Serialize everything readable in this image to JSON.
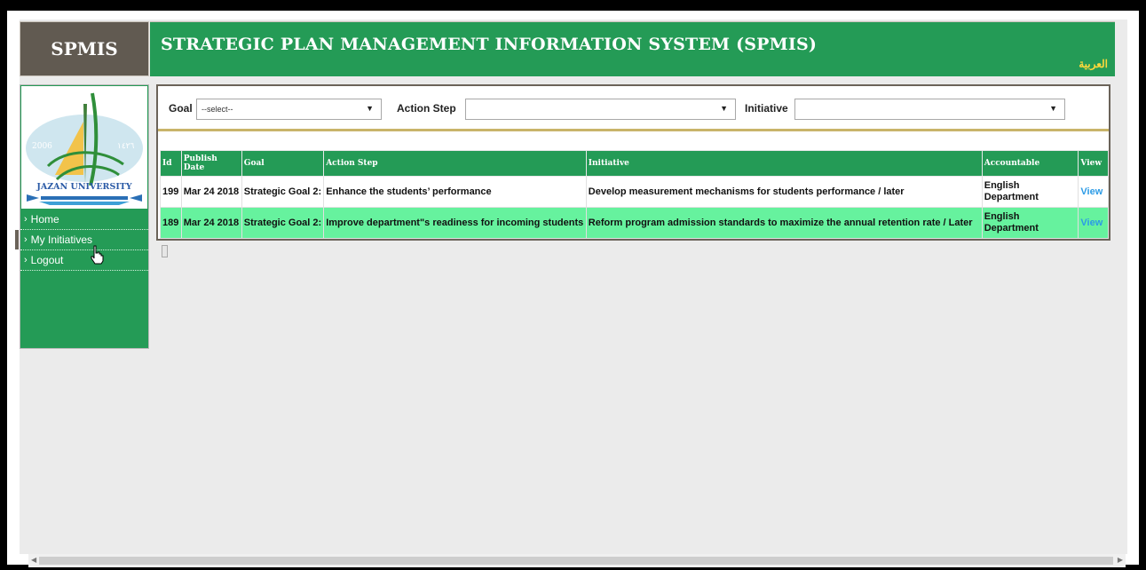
{
  "brand": "SPMIS",
  "header": {
    "title": "STRATEGIC PLAN MANAGEMENT INFORMATION SYSTEM (SPMIS)",
    "language_link": "العربية"
  },
  "logo": {
    "year_left": "2006",
    "year_right": "١٤٢٦",
    "university": "JAZAN UNIVERSITY"
  },
  "menu": [
    {
      "label": "Home"
    },
    {
      "label": "My Initiatives"
    },
    {
      "label": "Logout"
    }
  ],
  "filters": {
    "goal_label": "Goal",
    "goal_value": "--select--",
    "action_step_label": "Action Step",
    "action_step_value": "",
    "initiative_label": "Initiative",
    "initiative_value": ""
  },
  "table": {
    "headers": [
      "Id",
      "Publish Date",
      "Goal",
      "Action Step",
      "Initiative",
      "Accountable",
      "View"
    ],
    "rows": [
      {
        "id": "199",
        "date": "Mar 24 2018",
        "goal": "Strategic Goal 2:",
        "action_step": "Enhance the students’ performance",
        "initiative": "Develop measurement mechanisms for students performance / later",
        "accountable": "English Department",
        "view": "View"
      },
      {
        "id": "189",
        "date": "Mar 24 2018",
        "goal": "Strategic Goal 2:",
        "action_step": "Improve department\"s readiness for incoming students",
        "initiative": "Reform program admission standards to maximize the annual retention rate / Later",
        "accountable": "English Department",
        "view": "View"
      }
    ]
  },
  "colors": {
    "header_green": "#249b56",
    "brand_brown": "#615a51",
    "row_highlight": "#66f29e",
    "link_blue": "#2c9be6",
    "lang_yellow": "#ffd93b"
  }
}
